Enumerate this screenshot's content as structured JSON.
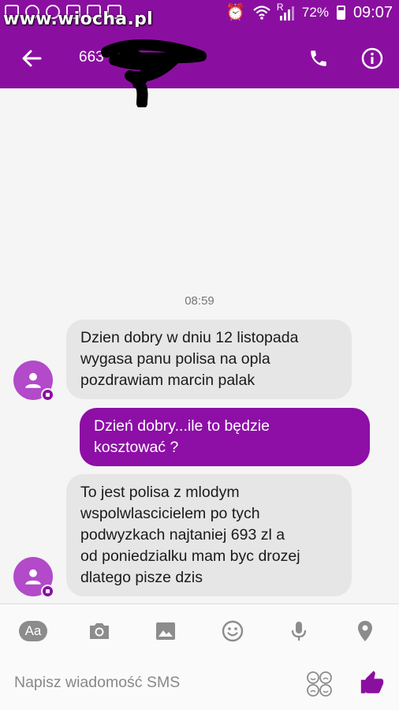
{
  "status_bar": {
    "watermark": "www.wiocha.pl",
    "signal_label": "R",
    "battery": "72%",
    "time": "09:07"
  },
  "header": {
    "contact_partial": "663",
    "icons": [
      "back-arrow-icon",
      "phone-icon",
      "info-icon"
    ]
  },
  "conversation": {
    "timestamp": "08:59",
    "messages": [
      {
        "direction": "incoming",
        "text": "Dzien dobry w dniu 12 listopada\nwygasa panu polisa na opla\npozdrawiam marcin palak"
      },
      {
        "direction": "outgoing",
        "text": "Dzień dobry...ile to będzie\nkosztować ?"
      },
      {
        "direction": "incoming",
        "text": "To jest polisa z mlodym\nwspolwlascicielem po tych\npodwyzkach najtaniej 693 zl a\nod poniedzialku mam byc drozej\ndlatego pisze dzis"
      }
    ]
  },
  "composer": {
    "aa_label": "Aa",
    "placeholder": "Napisz wiadomość SMS",
    "tools": [
      "text-format-icon",
      "camera-icon",
      "image-icon",
      "emoji-icon",
      "microphone-icon",
      "location-icon"
    ]
  },
  "colors": {
    "accent": "#8a0fa0",
    "outgoing_bubble": "#8d0fa6",
    "incoming_bubble": "#e6e6e6",
    "avatar": "#b24ac9"
  }
}
